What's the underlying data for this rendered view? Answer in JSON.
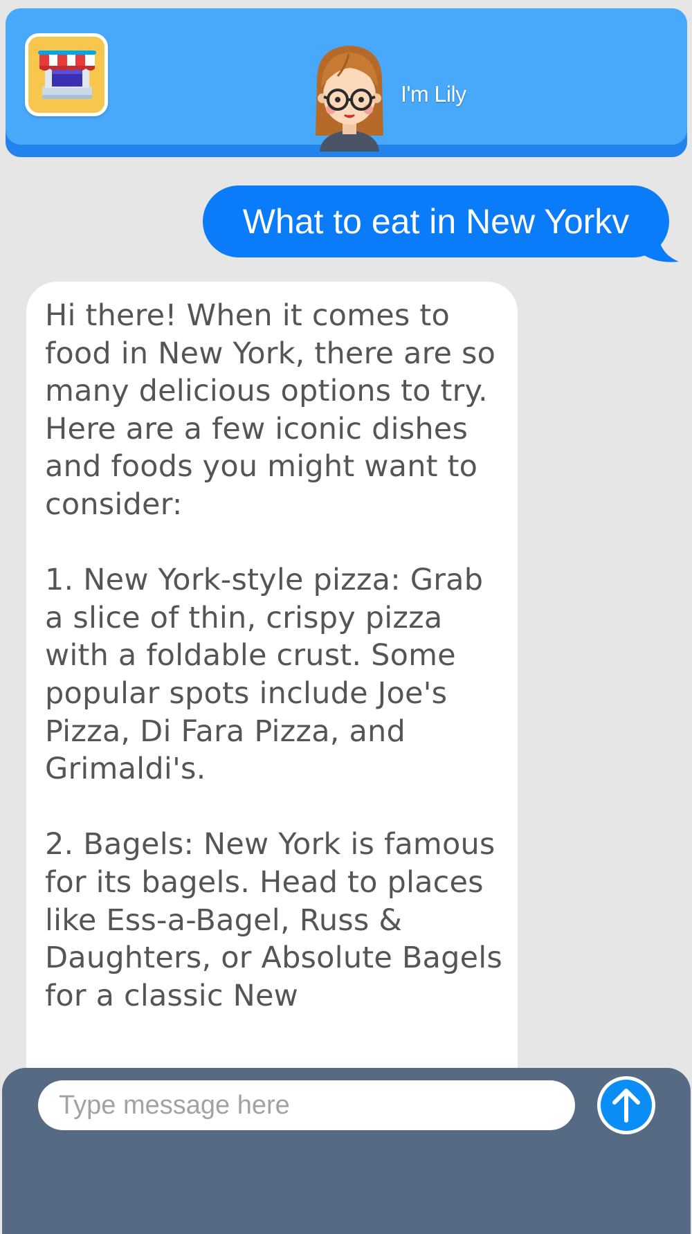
{
  "header": {
    "title": "I'm Lily",
    "store_icon": "store-icon",
    "avatar_icon": "girl-with-glasses-avatar",
    "background_color": "#48a9fb"
  },
  "conversation": {
    "user_message": "What to eat in New Yorkv",
    "bot_message": "Hi there! When it comes to food in New York, there are so many delicious options to try. Here are a few iconic dishes and foods you might want to consider:\n\n1. New York-style pizza: Grab a slice of thin, crispy pizza with a foldable crust. Some popular spots include Joe's Pizza, Di Fara Pizza, and Grimaldi's.\n\n2. Bagels: New York is famous for its bagels. Head to places like Ess-a-Bagel, Russ & Daughters, or Absolute Bagels for a classic New",
    "user_bubble_color": "#0a7cfa"
  },
  "composer": {
    "placeholder": "Type message here",
    "send_icon": "arrow-up-icon",
    "bar_color": "#566a83"
  }
}
